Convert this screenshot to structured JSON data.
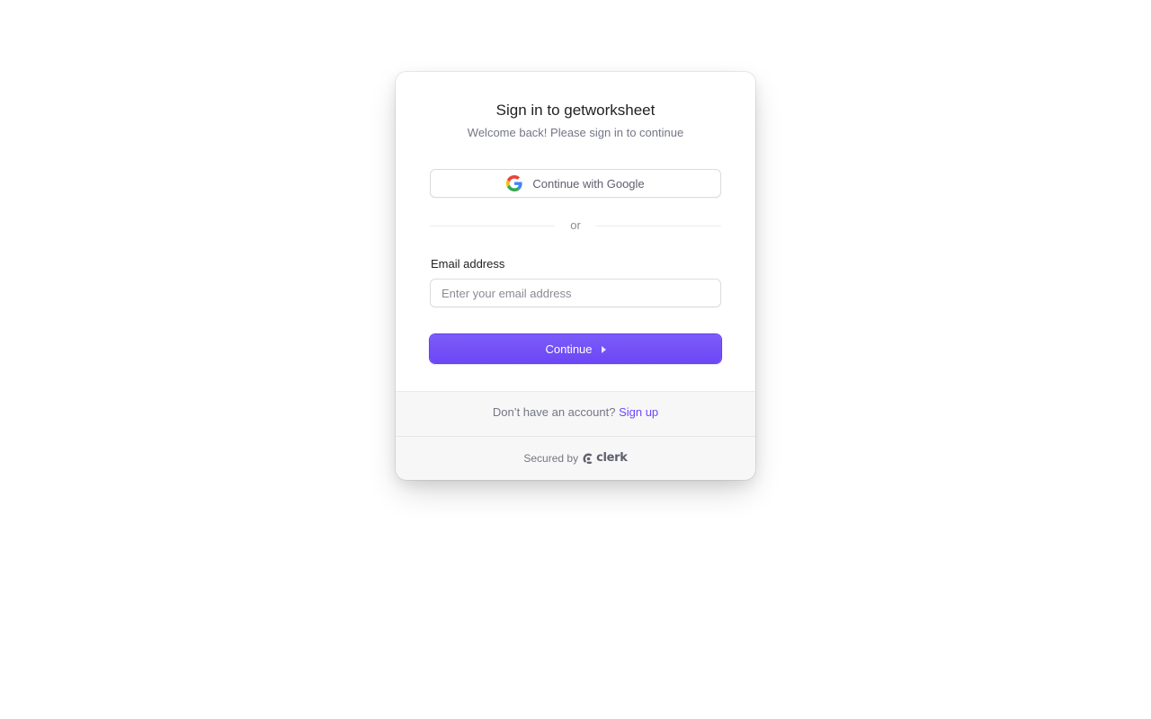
{
  "card": {
    "title": "Sign in to getworksheet",
    "subtitle": "Welcome back! Please sign in to continue"
  },
  "social": {
    "google_label": "Continue with Google",
    "google_icon": "google-icon"
  },
  "divider": {
    "text": "or"
  },
  "email": {
    "label": "Email address",
    "value": "",
    "placeholder": "Enter your email address"
  },
  "primary": {
    "continue_label": "Continue",
    "icon": "arrow-right-icon",
    "color": "#6c47ff"
  },
  "footer": {
    "signup_prompt": "Don’t have an account?",
    "signup_link": "Sign up",
    "secured_by": "Secured by",
    "brand": "clerk",
    "brand_icon": "clerk-logo-icon"
  }
}
